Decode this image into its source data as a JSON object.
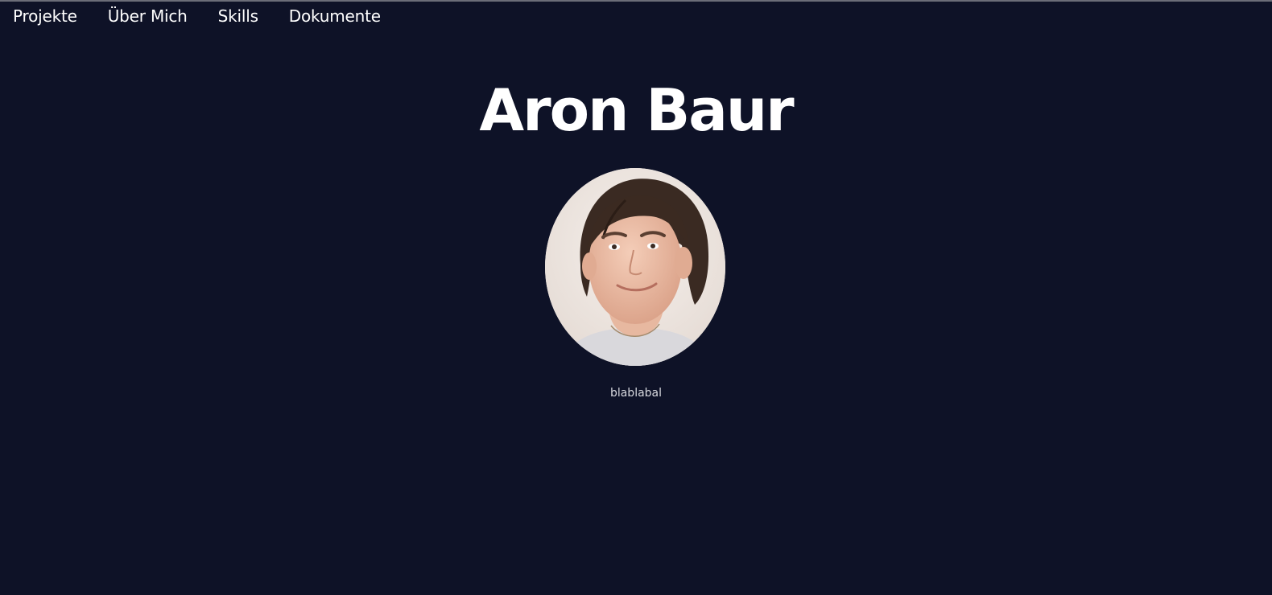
{
  "nav": {
    "items": [
      {
        "label": "Projekte"
      },
      {
        "label": "Über Mich"
      },
      {
        "label": "Skills"
      },
      {
        "label": "Dokumente"
      }
    ]
  },
  "hero": {
    "title": "Aron Baur",
    "caption": "blablabal"
  },
  "colors": {
    "background": "#0e1227",
    "text": "#ffffff",
    "caption": "#d8d9df"
  }
}
